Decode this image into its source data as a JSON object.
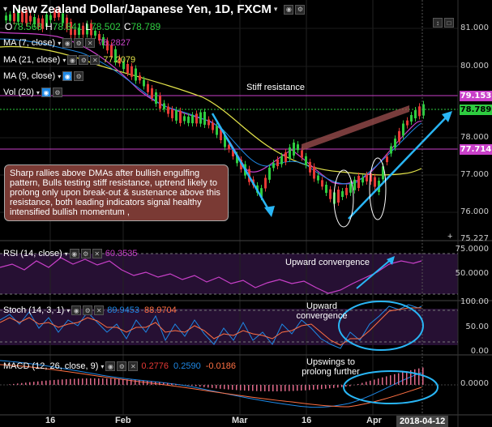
{
  "header": {
    "title": "New Zealand Dollar/Japanese Yen, 1D, FXCM",
    "ohlc": {
      "o_label": "O",
      "o": "78.568",
      "h_label": "H",
      "h": "78.841",
      "l_label": "L",
      "l": "78.502",
      "c_label": "C",
      "c": "78.789"
    }
  },
  "studies": {
    "ma7": {
      "label": "MA (7, close)",
      "value": "78.2827",
      "color": "#c940c9"
    },
    "ma21": {
      "label": "MA (21, close)",
      "value": "77.2079",
      "color": "#e3e34a"
    },
    "ma9": {
      "label": "MA (9, close)"
    },
    "vol": {
      "label": "Vol (20)"
    }
  },
  "price_axis": {
    "ticks": [
      "81.000",
      "80.000",
      "78.000",
      "77.000",
      "76.000",
      "75.227"
    ],
    "tags": {
      "resistance": "79.153",
      "current": "78.789",
      "support": "77.714"
    }
  },
  "annotations": {
    "stiff_resistance": "Stiff resistance",
    "comment": "Sharp rallies above DMAs after bullish engulfing pattern, Bulls testing stiff resistance, uptrend likely to prolong only upon break-out & sustenance above this resistance, both leading indicators signal healthy intensified bullish momentum ,",
    "rsi_note": "Upward convergence",
    "stoch_note": "Upward convergence",
    "macd_note": "Upswings to prolong further"
  },
  "rsi": {
    "label": "RSI (14, close)",
    "value": "60.3535",
    "ticks": [
      "75.0000",
      "50.0000"
    ]
  },
  "stoch": {
    "label": "Stoch (14, 3, 1)",
    "k": "89.9453",
    "d": "88.9704",
    "ticks": [
      "100.00",
      "50.00",
      "0.00"
    ]
  },
  "macd": {
    "label": "MACD (12, 26, close, 9)",
    "hist": "0.2776",
    "macd": "0.2590",
    "signal": "-0.0186",
    "ticks": [
      "0.0000"
    ]
  },
  "time_axis": {
    "labels": [
      "16",
      "Feb",
      "Mar",
      "16",
      "Apr"
    ],
    "current": "2018-04-12"
  },
  "colors": {
    "bull": "#2ecc40",
    "bear": "#e53935",
    "resistance": "#c940c9",
    "accent": "#29b6f6"
  }
}
